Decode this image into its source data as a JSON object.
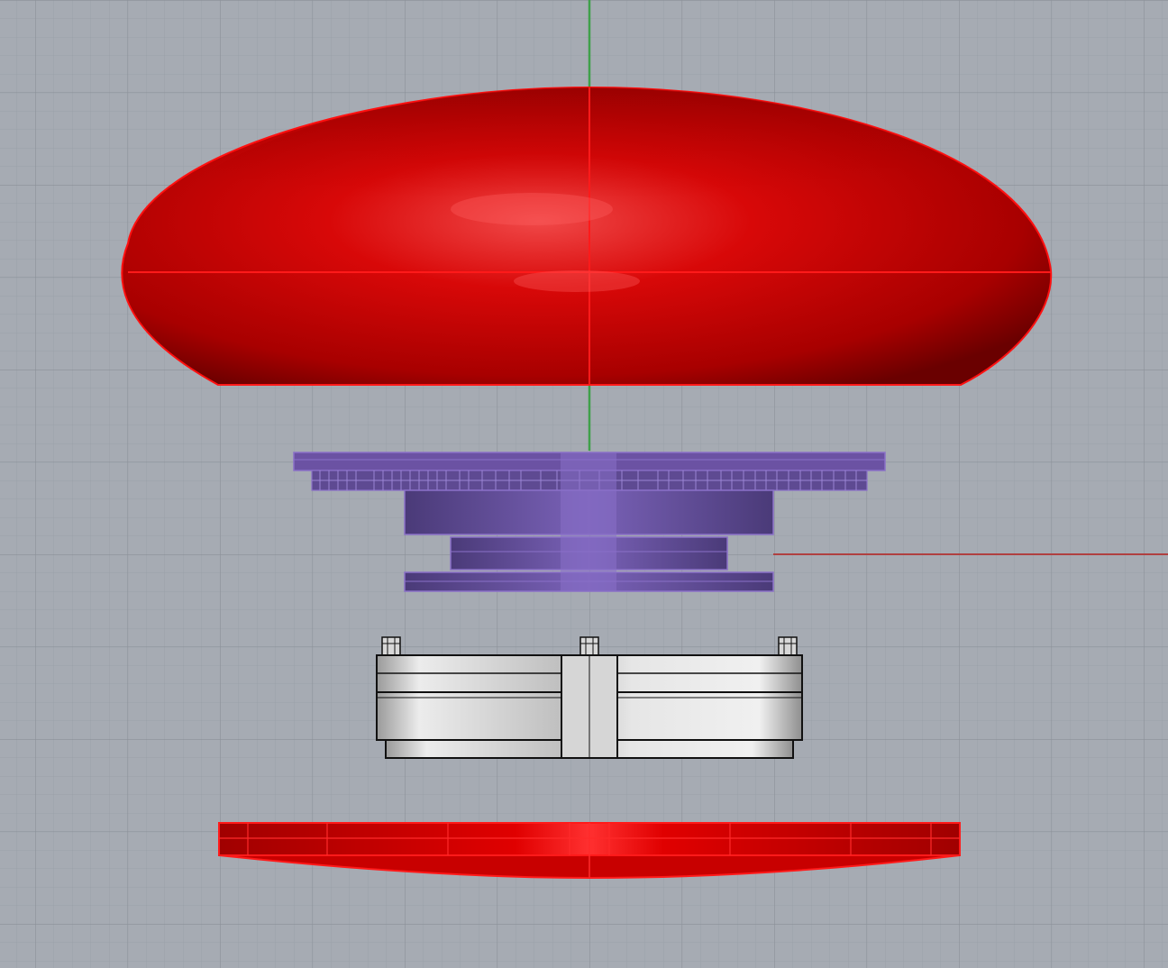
{
  "viewport": {
    "background": "#a6abb3",
    "grid_minor_color": "#9aa0a8",
    "grid_major_color": "#8c9199",
    "y_axis_color": "#3fa04a",
    "x_axis_color": "#b04040"
  },
  "objects": [
    {
      "name": "dome-cap",
      "color": "#d40000",
      "description_visible": false
    },
    {
      "name": "button-mechanism",
      "color": "#6b52a3"
    },
    {
      "name": "switch-housing",
      "color": "#c8c8c8"
    },
    {
      "name": "base-plate",
      "color": "#e00000"
    }
  ]
}
